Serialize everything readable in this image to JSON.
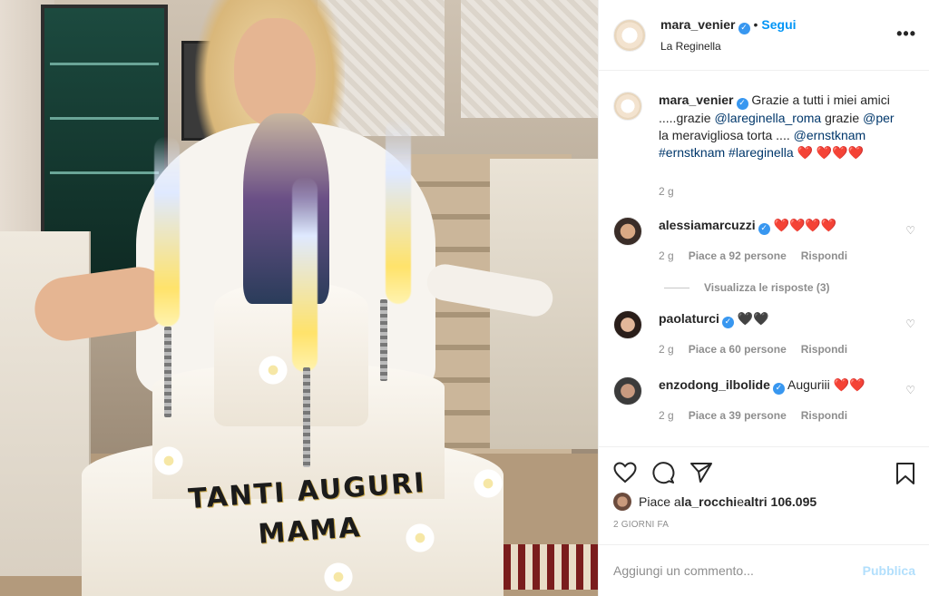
{
  "post": {
    "author": "mara_venier",
    "follow_label": "Segui",
    "location": "La Reginella",
    "more_label": "•••",
    "cake_text_line1": "TANTI AUGURI",
    "cake_text_line2": "MAMA",
    "caption": {
      "author": "mara_venier",
      "text1": "Grazie a tutti i miei amici .....grazie ",
      "mention1": "@lareginella_roma",
      "text2": " grazie ",
      "mention2": "@per",
      "text3": " la meravigliosa torta .... ",
      "mention3": "@ernstknam",
      "hashtag1": "#ernstknam",
      "hashtag2": "#lareginella",
      "hearts": "❤️ ❤️❤️❤️",
      "time": "2 g"
    }
  },
  "comments": [
    {
      "user": "alessiamarcuzzi",
      "text": "❤️❤️❤️❤️",
      "time": "2 g",
      "likes": "Piace a 92 persone",
      "reply": "Rispondi",
      "view_replies": "Visualizza le risposte (3)"
    },
    {
      "user": "paolaturci",
      "text": "🖤🖤",
      "time": "2 g",
      "likes": "Piace a 60 persone",
      "reply": "Rispondi"
    },
    {
      "user": "enzodong_ilbolide",
      "text": "Auguriii ❤️❤️",
      "time": "2 g",
      "likes": "Piace a 39 persone",
      "reply": "Rispondi"
    }
  ],
  "likes": {
    "prefix": "Piace a ",
    "user": "la_rocchi",
    "mid": " e ",
    "rest": "altri 106.095"
  },
  "date": "2 GIORNI FA",
  "add_comment": {
    "placeholder": "Aggiungi un commento...",
    "publish": "Pubblica"
  },
  "colors": {
    "accent": "#0095f6",
    "verified": "#3897f0",
    "heart": "#e0245e"
  }
}
